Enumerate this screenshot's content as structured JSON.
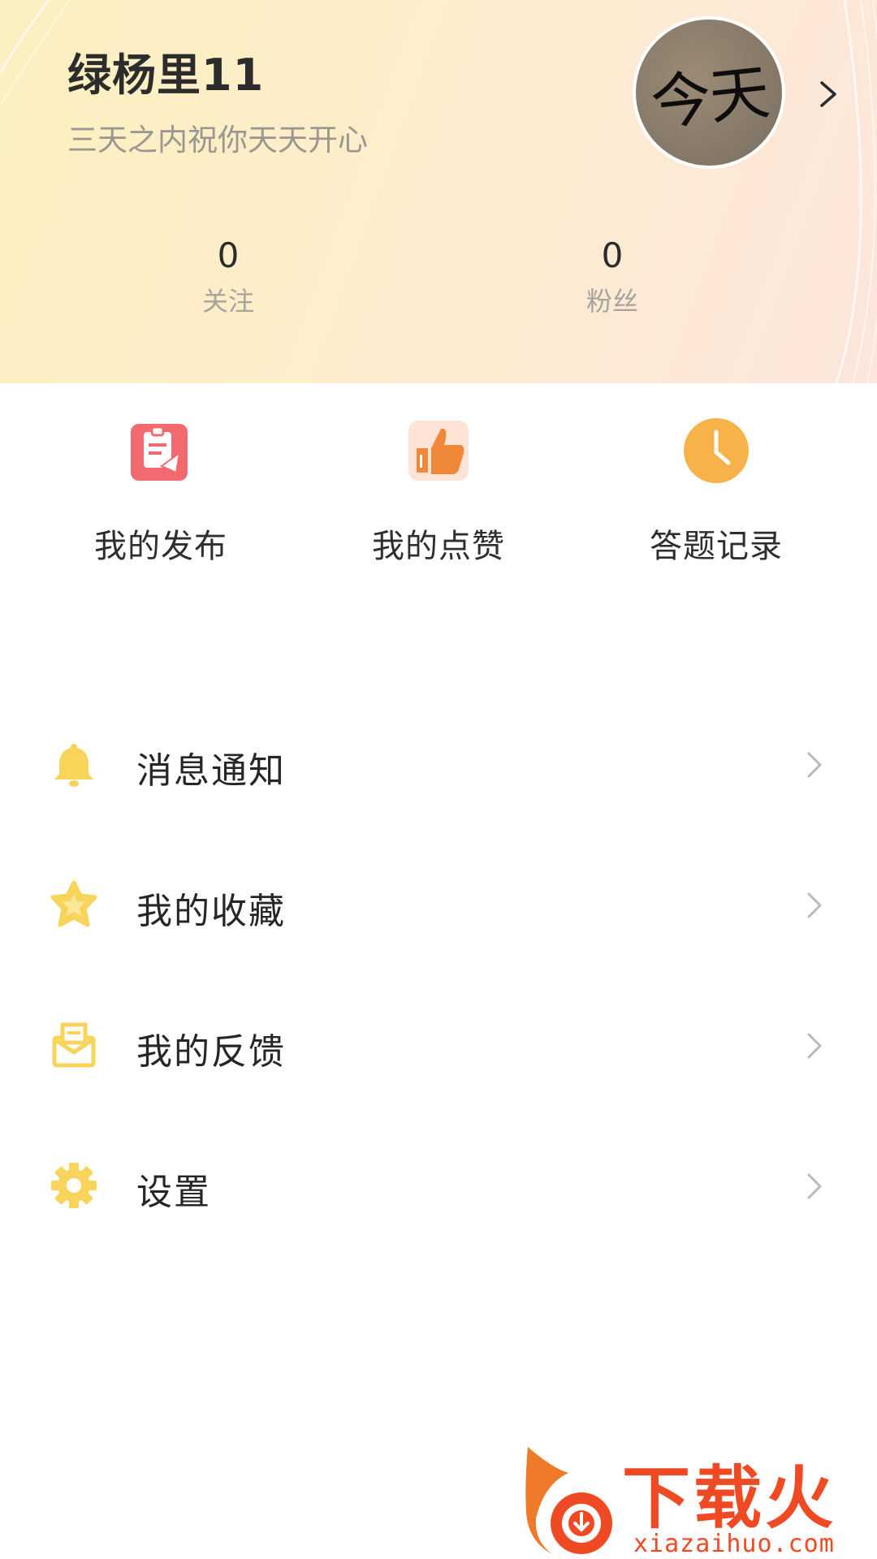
{
  "profile": {
    "username": "绿杨里11",
    "bio": "三天之内祝你天天开心",
    "avatar_text": "今天",
    "stats": [
      {
        "value": "0",
        "label": "关注"
      },
      {
        "value": "0",
        "label": "粉丝"
      }
    ]
  },
  "quick_actions": [
    {
      "label": "我的发布",
      "icon": "publish-icon",
      "color": "#f2616a"
    },
    {
      "label": "我的点赞",
      "icon": "thumbs-up-icon",
      "color": "#f0883a"
    },
    {
      "label": "答题记录",
      "icon": "clock-icon",
      "color": "#f7b24a"
    }
  ],
  "menu": [
    {
      "label": "消息通知",
      "icon": "bell-icon"
    },
    {
      "label": "我的收藏",
      "icon": "star-icon"
    },
    {
      "label": "我的反馈",
      "icon": "feedback-mail-icon"
    },
    {
      "label": "设置",
      "icon": "gear-icon"
    }
  ],
  "colors": {
    "menu_icon_yellow": "#f8d45a",
    "header_gradient_start": "#fbf0bf",
    "header_gradient_end": "#fce6dc",
    "watermark_red": "#f04a25"
  },
  "watermark": {
    "text": "下载火",
    "url": "xiazaihuo.com"
  }
}
